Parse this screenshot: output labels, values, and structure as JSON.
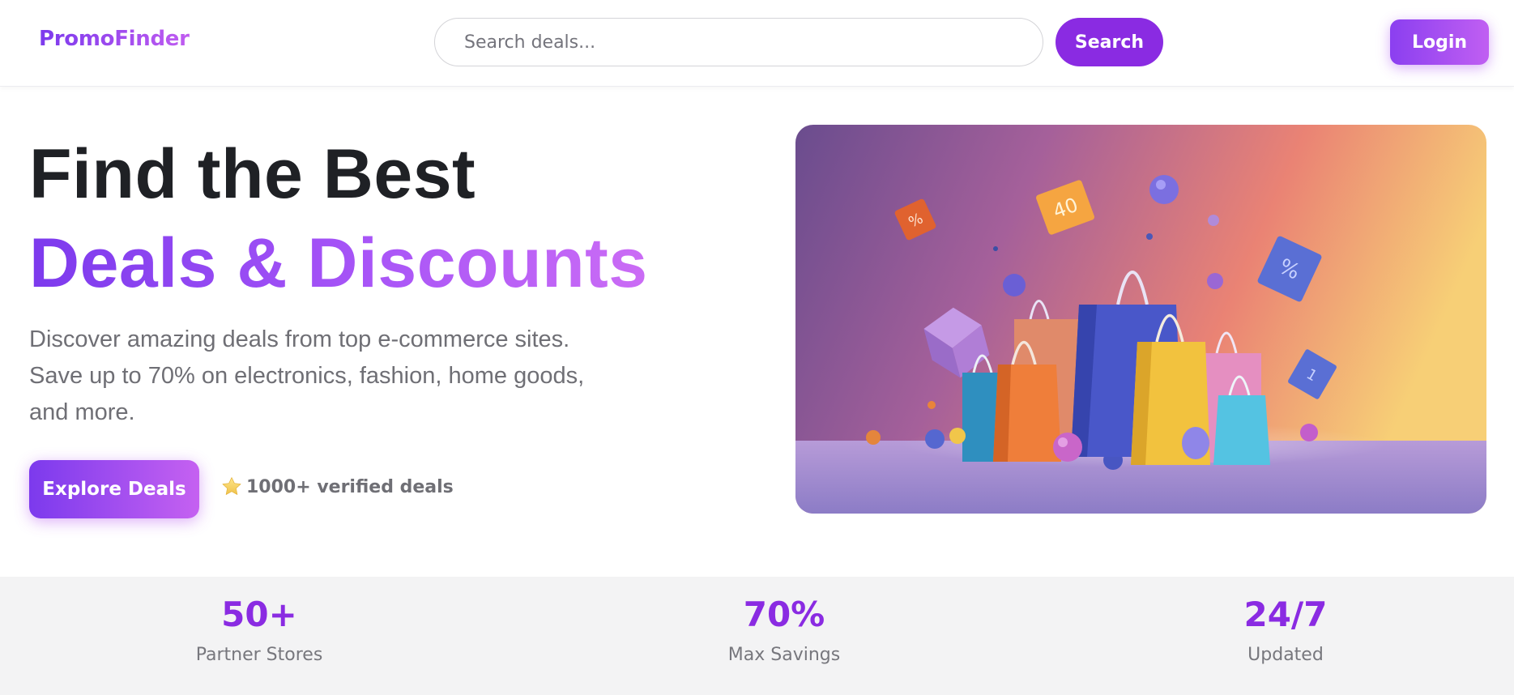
{
  "header": {
    "logo": "PromoFinder",
    "search_placeholder": "Search deals...",
    "search_button": "Search",
    "login_button": "Login"
  },
  "hero": {
    "title_line1": "Find the Best",
    "title_line2": "Deals & Discounts",
    "description": "Discover amazing deals from top e-commerce sites. Save up to 70% on electronics, fashion, home goods, and more.",
    "cta_button": "Explore Deals",
    "verified_text": "1000+ verified deals",
    "verified_icon": "star-icon",
    "image_icon": "shopping-bags-illustration"
  },
  "stats": [
    {
      "value": "50+",
      "label": "Partner Stores"
    },
    {
      "value": "70%",
      "label": "Max Savings"
    },
    {
      "value": "24/7",
      "label": "Updated"
    }
  ],
  "colors": {
    "brand": "#8a2be2",
    "brand_gradient_start": "#7c3aed",
    "brand_gradient_end": "#c561f1",
    "text_dark": "#1f2125",
    "text_muted": "#6f6f75"
  }
}
